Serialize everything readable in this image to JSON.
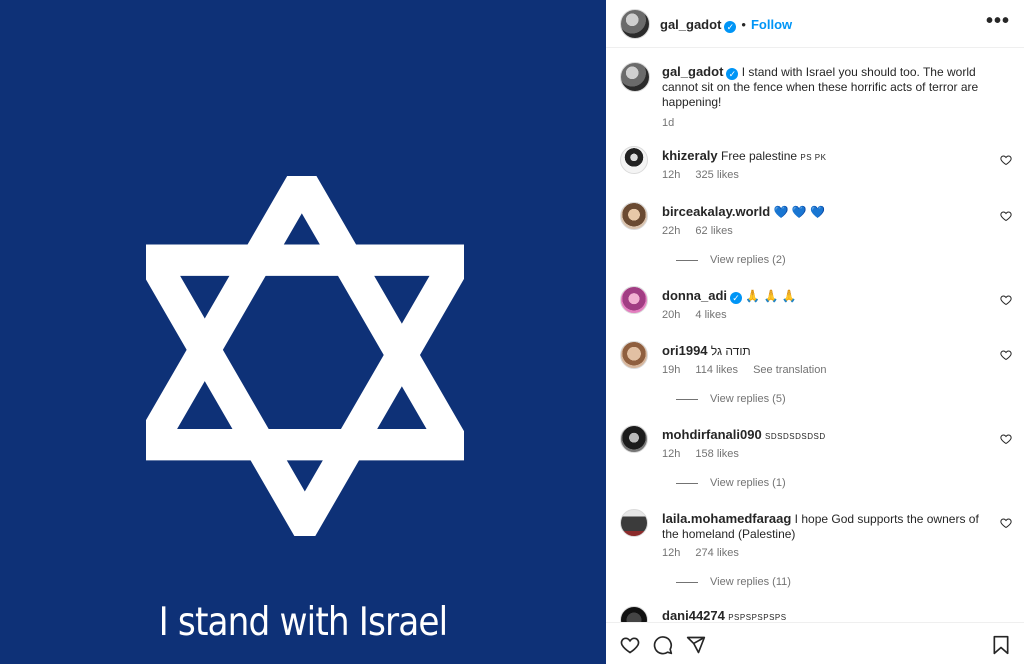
{
  "media": {
    "caption": "I stand with Israel",
    "background_color": "#0e3177"
  },
  "header": {
    "username": "gal_gadot",
    "follow_label": "Follow",
    "more_icon": "more-horizontal-icon"
  },
  "post_caption": {
    "username": "gal_gadot",
    "text": "I stand with Israel you should too. The world cannot sit on the fence when these horrific acts of terror are happening!",
    "time": "1d"
  },
  "comments": [
    {
      "username": "khizeraly",
      "text": "Free palestine",
      "extra": "PS PK",
      "time": "12h",
      "likes": "325 likes"
    },
    {
      "username": "birceakalay.world",
      "text": "💙 💙 💙",
      "time": "22h",
      "likes": "62 likes",
      "view_replies": "View replies (2)"
    },
    {
      "username": "donna_adi",
      "text": "🙏 🙏 🙏",
      "time": "20h",
      "likes": "4 likes"
    },
    {
      "username": "ori1994",
      "text": "תודה גל",
      "time": "19h",
      "likes": "114 likes",
      "see_translation": "See translation",
      "view_replies": "View replies (5)"
    },
    {
      "username": "mohdirfanali090",
      "extra": "SDSDSDSDSD",
      "time": "12h",
      "likes": "158 likes",
      "view_replies": "View replies (1)"
    },
    {
      "username": "laila.mohamedfaraag",
      "text": "I hope God supports the owners of the homeland (Palestine)",
      "time": "12h",
      "likes": "274 likes",
      "view_replies": "View replies (11)"
    },
    {
      "username": "dani44274",
      "extra": "PSPSPSPSPS"
    }
  ],
  "footer": {
    "icons": [
      "heart-icon",
      "comment-icon",
      "share-icon",
      "bookmark-icon"
    ]
  }
}
